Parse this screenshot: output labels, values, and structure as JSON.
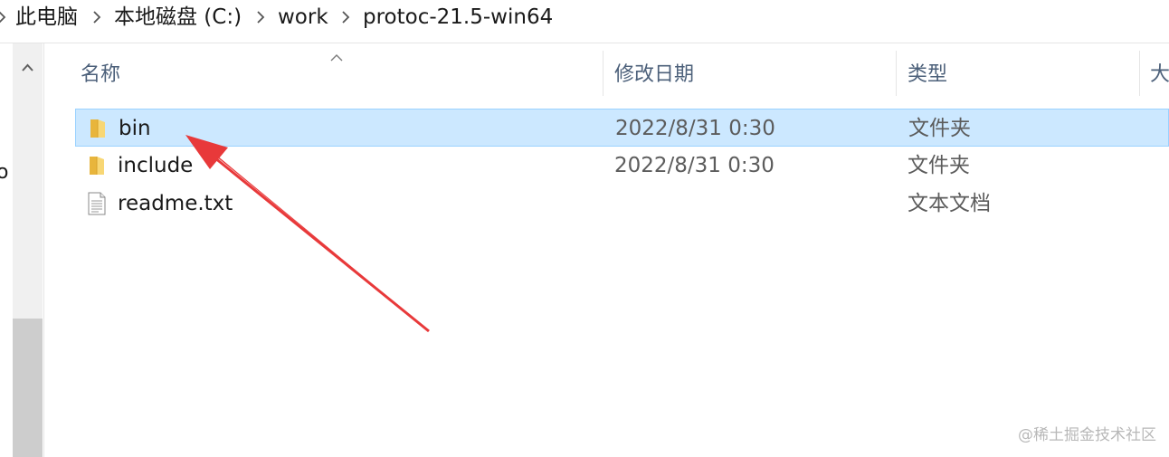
{
  "address_bar": {
    "items": [
      {
        "label": "此电脑"
      },
      {
        "label": "本地磁盘 (C:)"
      },
      {
        "label": "work"
      },
      {
        "label": "protoc-21.5-win64"
      }
    ]
  },
  "nav_pane": {
    "edge_text": "o"
  },
  "columns": {
    "name": "名称",
    "date": "修改日期",
    "type": "类型",
    "size": "大"
  },
  "files": [
    {
      "name": "bin",
      "date": "2022/8/31 0:30",
      "type": "文件夹",
      "icon": "folder-icon",
      "selected": true
    },
    {
      "name": "include",
      "date": "2022/8/31 0:30",
      "type": "文件夹",
      "icon": "folder-icon",
      "selected": false
    },
    {
      "name": "readme.txt",
      "date": "",
      "type": "文本文档",
      "icon": "text-file-icon",
      "selected": false
    }
  ],
  "colors": {
    "selection_bg": "#cce8ff",
    "selection_border": "#99d1ff",
    "arrow": "#e8393a",
    "header_text": "#4c607a"
  },
  "watermark": "@稀土掘金技术社区"
}
